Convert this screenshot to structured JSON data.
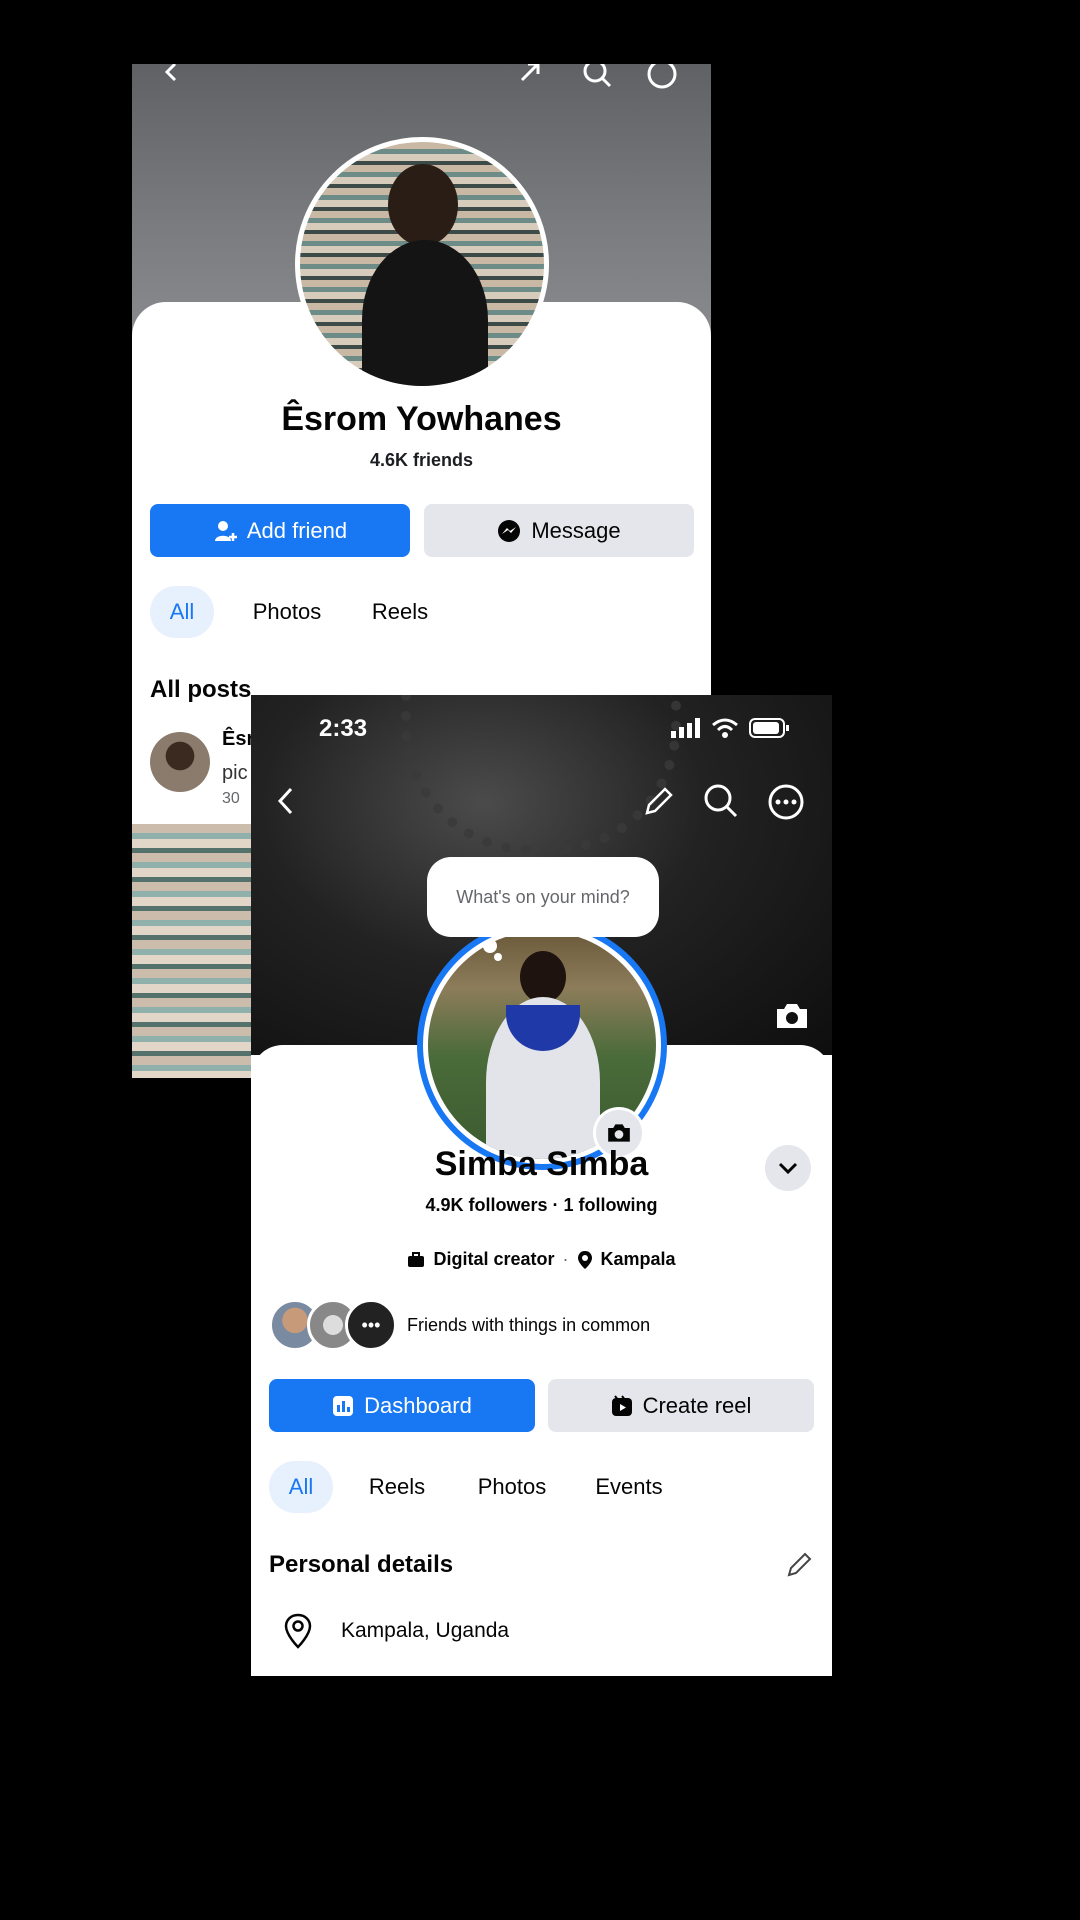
{
  "back_profile": {
    "name": "Êsrom Yowhanes",
    "friends": "4.6K friends",
    "add_friend_label": "Add friend",
    "message_label": "Message",
    "tabs": [
      {
        "label": "All",
        "active": true
      },
      {
        "label": "Photos",
        "active": false
      },
      {
        "label": "Reels",
        "active": false
      }
    ],
    "section_title": "All posts",
    "post": {
      "author_partial": "Êsr",
      "text_partial": "pic",
      "time_partial": "30"
    }
  },
  "front_profile": {
    "status_time": "2:33",
    "composer_placeholder": "What's on your mind?",
    "name": "Simba Simba",
    "stats": "4.9K followers · 1 following",
    "category": "Digital creator",
    "meta_separator": "·",
    "location_short": "Kampala",
    "mutual_text": "Friends with things in common",
    "dashboard_label": "Dashboard",
    "create_reel_label": "Create reel",
    "tabs": [
      {
        "label": "All",
        "active": true
      },
      {
        "label": "Reels",
        "active": false
      },
      {
        "label": "Photos",
        "active": false
      },
      {
        "label": "Events",
        "active": false
      }
    ],
    "personal_details_title": "Personal details",
    "location_full": "Kampala, Uganda"
  },
  "colors": {
    "accent_blue": "#1877f2",
    "button_gray": "#e4e6eb",
    "active_tab_bg": "#e7f0fd",
    "background": "#000000"
  },
  "icons": [
    "back-icon",
    "edit-pencil-icon",
    "search-icon",
    "more-icon",
    "camera-icon",
    "chevron-down-icon",
    "briefcase-icon",
    "location-pin-icon",
    "add-friend-icon",
    "messenger-icon",
    "dashboard-icon",
    "reel-icon",
    "signal-icon",
    "wifi-icon",
    "battery-icon"
  ]
}
